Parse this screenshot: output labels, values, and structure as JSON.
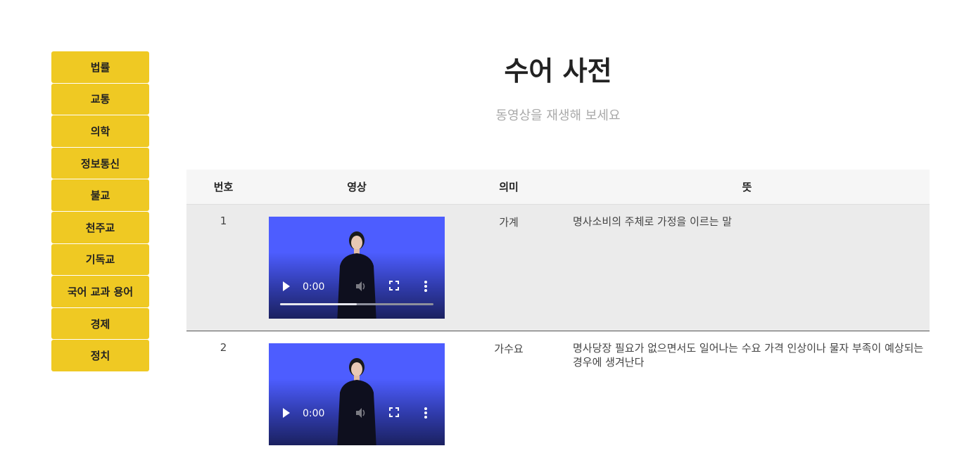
{
  "sidebar": {
    "items": [
      {
        "label": "법률"
      },
      {
        "label": "교통"
      },
      {
        "label": "의학"
      },
      {
        "label": "정보통신"
      },
      {
        "label": "불교"
      },
      {
        "label": "천주교"
      },
      {
        "label": "기독교"
      },
      {
        "label": "국어 교과 용어"
      },
      {
        "label": "경제"
      },
      {
        "label": "정치"
      }
    ]
  },
  "header": {
    "title": "수어 사전",
    "subtitle": "동영상을 재생해 보세요"
  },
  "table": {
    "columns": [
      "번호",
      "영상",
      "의미",
      "뜻"
    ],
    "rows": [
      {
        "no": "1",
        "video": {
          "time": "0:00",
          "progress": 0.5
        },
        "meaning": "가계",
        "definition": "명사소비의 주체로 가정을 이르는 말"
      },
      {
        "no": "2",
        "video": {
          "time": "0:00",
          "progress": 0.0
        },
        "meaning": "가수요",
        "definition": "명사당장 필요가 없으면서도 일어나는 수요 가격 인상이나 물자 부족이 예상되는 경우에 생겨난다"
      }
    ]
  },
  "colors": {
    "sidebar_button": "#efc923",
    "video_background": "#4d5dff",
    "row_highlight": "#ebebeb"
  }
}
